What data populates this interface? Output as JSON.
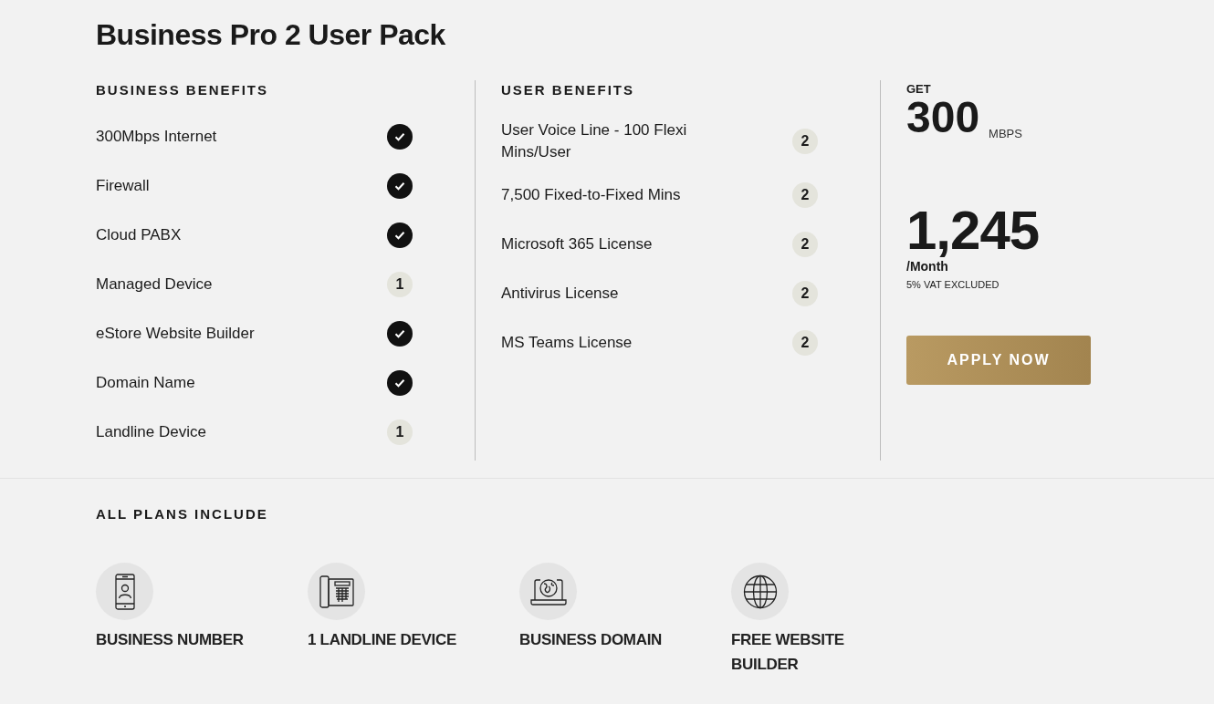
{
  "title": "Business Pro 2 User Pack",
  "business_benefits": {
    "heading": "BUSINESS BENEFITS",
    "items": [
      {
        "label": "300Mbps Internet",
        "kind": "check"
      },
      {
        "label": "Firewall",
        "kind": "check"
      },
      {
        "label": "Cloud PABX",
        "kind": "check"
      },
      {
        "label": "Managed Device",
        "kind": "count",
        "count": "1"
      },
      {
        "label": "eStore Website Builder",
        "kind": "check"
      },
      {
        "label": "Domain Name",
        "kind": "check"
      },
      {
        "label": "Landline Device",
        "kind": "count",
        "count": "1"
      }
    ]
  },
  "user_benefits": {
    "heading": "USER BENEFITS",
    "items": [
      {
        "label": "User Voice Line - 100 Flexi Mins/User",
        "kind": "count",
        "count": "2"
      },
      {
        "label": "7,500 Fixed-to-Fixed Mins",
        "kind": "count",
        "count": "2"
      },
      {
        "label": "Microsoft 365 License",
        "kind": "count",
        "count": "2"
      },
      {
        "label": "Antivirus License",
        "kind": "count",
        "count": "2"
      },
      {
        "label": "MS Teams License",
        "kind": "count",
        "count": "2"
      }
    ]
  },
  "offer": {
    "speed_prefix": "GET",
    "speed": "300",
    "speed_unit": "MBPS",
    "price": "1,245",
    "period": "/Month",
    "vat_note": "5% VAT EXCLUDED",
    "button": "APPLY NOW"
  },
  "all_plans": {
    "heading": "ALL PLANS INCLUDE",
    "items": [
      {
        "label": "BUSINESS NUMBER",
        "kind": "phone"
      },
      {
        "label": "1 LANDLINE DEVICE",
        "kind": "deskphone"
      },
      {
        "label": "BUSINESS DOMAIN",
        "kind": "laptop"
      },
      {
        "label": "FREE WEBSITE BUILDER",
        "kind": "globe"
      }
    ]
  }
}
